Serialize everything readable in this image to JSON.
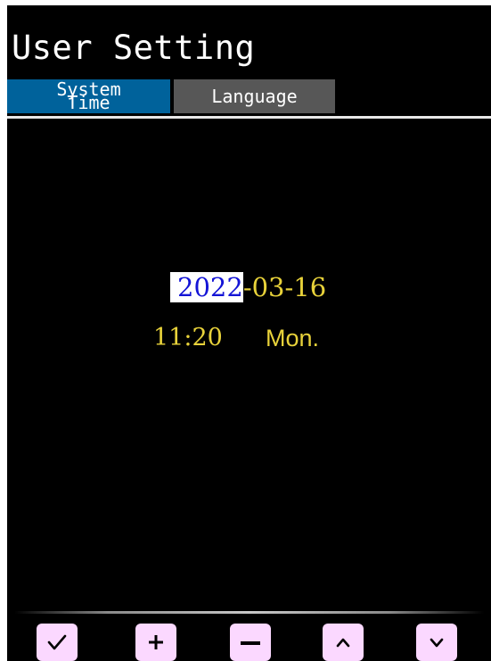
{
  "header": {
    "title": "User Setting"
  },
  "tabs": {
    "system_time": {
      "line1": "System",
      "line2": "Time",
      "active": true
    },
    "language": {
      "label": "Language",
      "active": false
    }
  },
  "datetime": {
    "year": "2022",
    "month_day": "-03-16",
    "time": "11:20",
    "weekday": "Mon.",
    "selected_field": "year"
  },
  "softkeys": [
    {
      "icon": "check-icon"
    },
    {
      "icon": "plus-icon"
    },
    {
      "icon": "minus-icon"
    },
    {
      "icon": "chevron-up-icon"
    },
    {
      "icon": "chevron-down-icon"
    }
  ],
  "colors": {
    "screen_bg": "#000000",
    "active_tab": "#00629b",
    "inactive_tab": "#575757",
    "value_text": "#e8d23a",
    "selection_bg": "#ffffff",
    "selection_text": "#1414d6",
    "softkey_bg": "#fbd8ff"
  }
}
